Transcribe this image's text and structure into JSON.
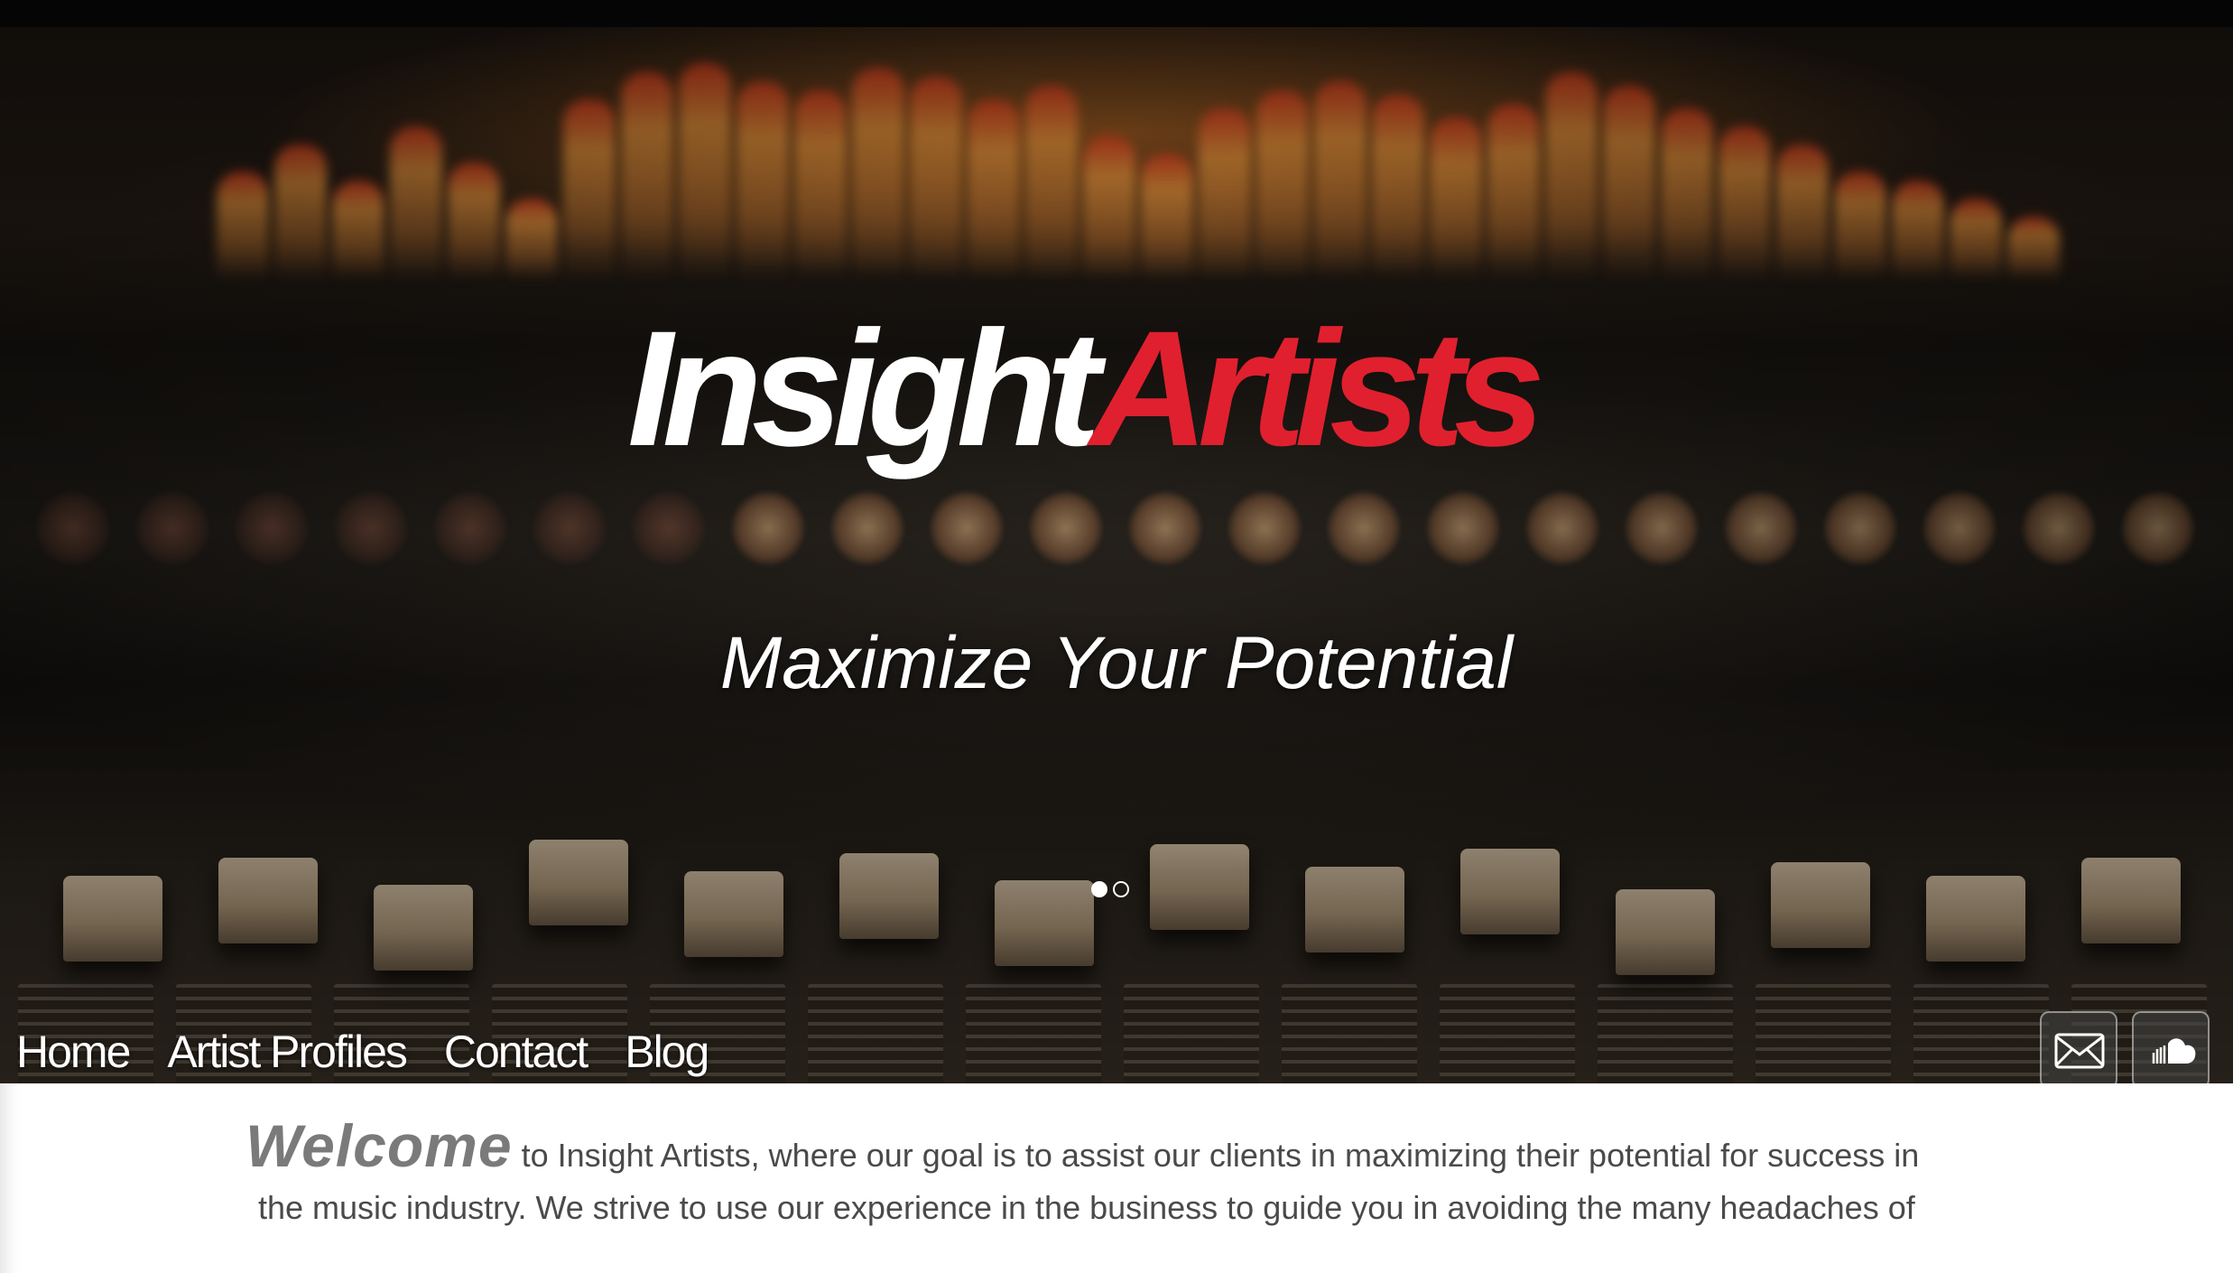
{
  "hero": {
    "logo_part1": "Insight",
    "logo_part2": "Artists",
    "tagline": "Maximize Your Potential",
    "slider": {
      "slides": 2,
      "active": 1
    }
  },
  "nav": {
    "items": [
      "Home",
      "Artist Profiles",
      "Contact",
      "Blog"
    ]
  },
  "social": {
    "mail_icon": "mail-icon",
    "cloud_icon": "soundcloud-icon"
  },
  "welcome": {
    "lead": "Welcome",
    "line1": "to Insight Artists, where our goal is to assist our clients in maximizing their potential for success in",
    "line2": "the music industry. We strive to use our experience in the business to guide you in avoiding the many headaches of"
  },
  "colors": {
    "brand_red": "#e0202e",
    "text_gray": "#4a4a4a",
    "welcome_gray": "#7a7a7a"
  }
}
